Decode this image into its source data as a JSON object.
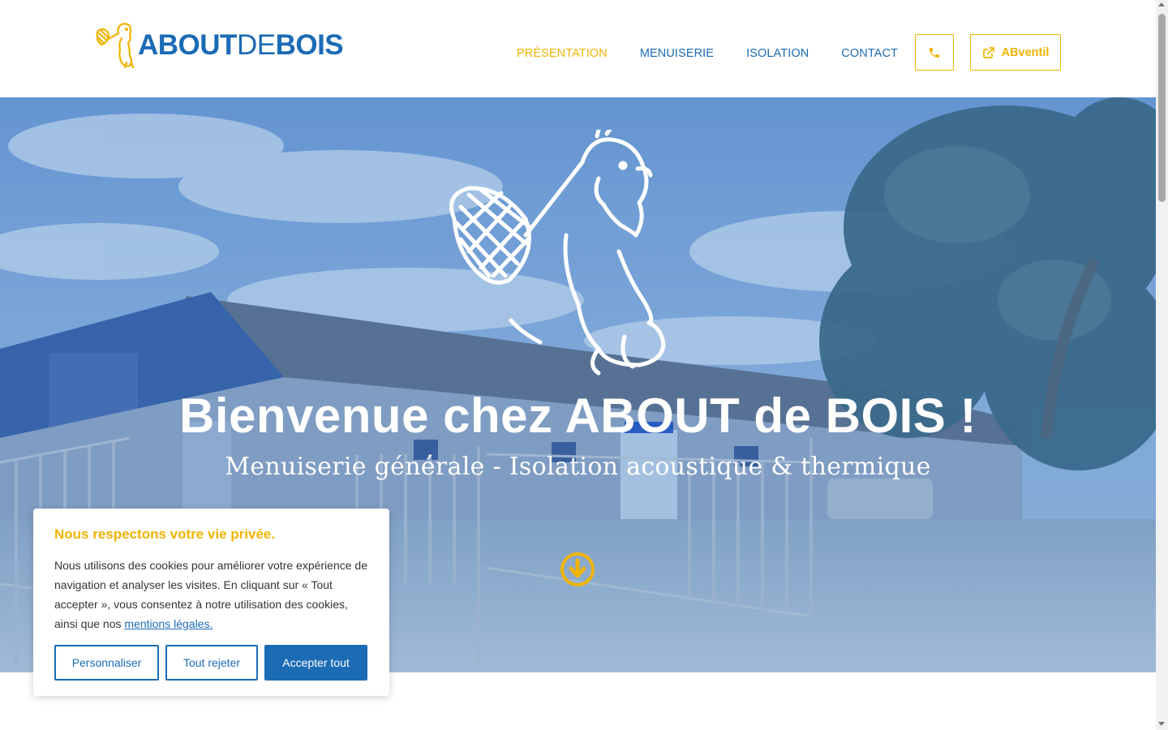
{
  "brand": {
    "logo_main": "ABOUT",
    "logo_mid": "DE",
    "logo_end": "BOIS",
    "primary_color": "#1b6bb5",
    "accent_color": "#f0b400"
  },
  "nav": {
    "items": [
      {
        "label": "PRÉSENTATION",
        "active": true
      },
      {
        "label": "MENUISERIE",
        "active": false
      },
      {
        "label": "ISOLATION",
        "active": false
      },
      {
        "label": "CONTACT",
        "active": false
      }
    ],
    "phone_icon": "phone-icon",
    "external_icon": "external-link-icon",
    "abventil_label": "ABventil"
  },
  "hero": {
    "title_part1": "Bienvenue chez ",
    "title_bold1": "ABOUT",
    "title_part2": " de ",
    "title_bold2": "BOIS",
    "title_part3": " !",
    "subtitle": "Menuiserie générale - Isolation acoustique & thermique",
    "scroll_icon": "arrow-down-circle-icon"
  },
  "cookie": {
    "title": "Nous respectons votre vie privée.",
    "text": "Nous utilisons des cookies pour améliorer votre expérience de navigation et analyser les visites. En cliquant sur « Tout accepter », vous consentez à notre utilisation des cookies, ainsi que nos ",
    "link": "mentions légales.",
    "btn_customize": "Personnaliser",
    "btn_reject": "Tout rejeter",
    "btn_accept": "Accepter tout"
  }
}
